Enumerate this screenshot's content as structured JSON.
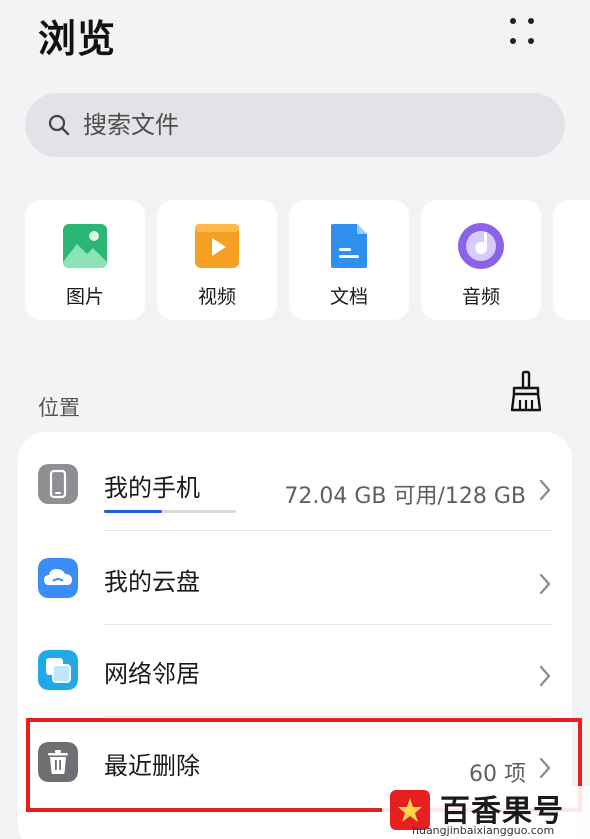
{
  "header": {
    "title": "浏览"
  },
  "search": {
    "placeholder": "搜索文件"
  },
  "categories": [
    {
      "label": "图片",
      "icon": "image-icon",
      "color": "#2bb673"
    },
    {
      "label": "视频",
      "icon": "video-icon",
      "color": "#f5a023"
    },
    {
      "label": "文档",
      "icon": "document-icon",
      "color": "#2e8fee"
    },
    {
      "label": "音频",
      "icon": "audio-icon",
      "color": "#8b63e8"
    }
  ],
  "locations": {
    "section_label": "位置",
    "items": [
      {
        "label": "我的手机",
        "detail": "72.04 GB 可用/128 GB",
        "icon": "phone-icon",
        "storage_used_fraction": 0.44
      },
      {
        "label": "我的云盘",
        "detail": "",
        "icon": "cloud-icon"
      },
      {
        "label": "网络邻居",
        "detail": "",
        "icon": "network-icon"
      },
      {
        "label": "最近删除",
        "detail": "60 项",
        "icon": "trash-icon"
      }
    ]
  },
  "colors": {
    "accent_blue": "#1e5fe0",
    "highlight_red": "#e62020",
    "phone_gray": "#8e8e93",
    "cloud_blue": "#3a8ef6",
    "network_cyan": "#1fa9e6",
    "trash_gray": "#6e6e73"
  },
  "watermark": {
    "brand": "百香果号",
    "url": "huangjinbaixiangguo.com"
  }
}
